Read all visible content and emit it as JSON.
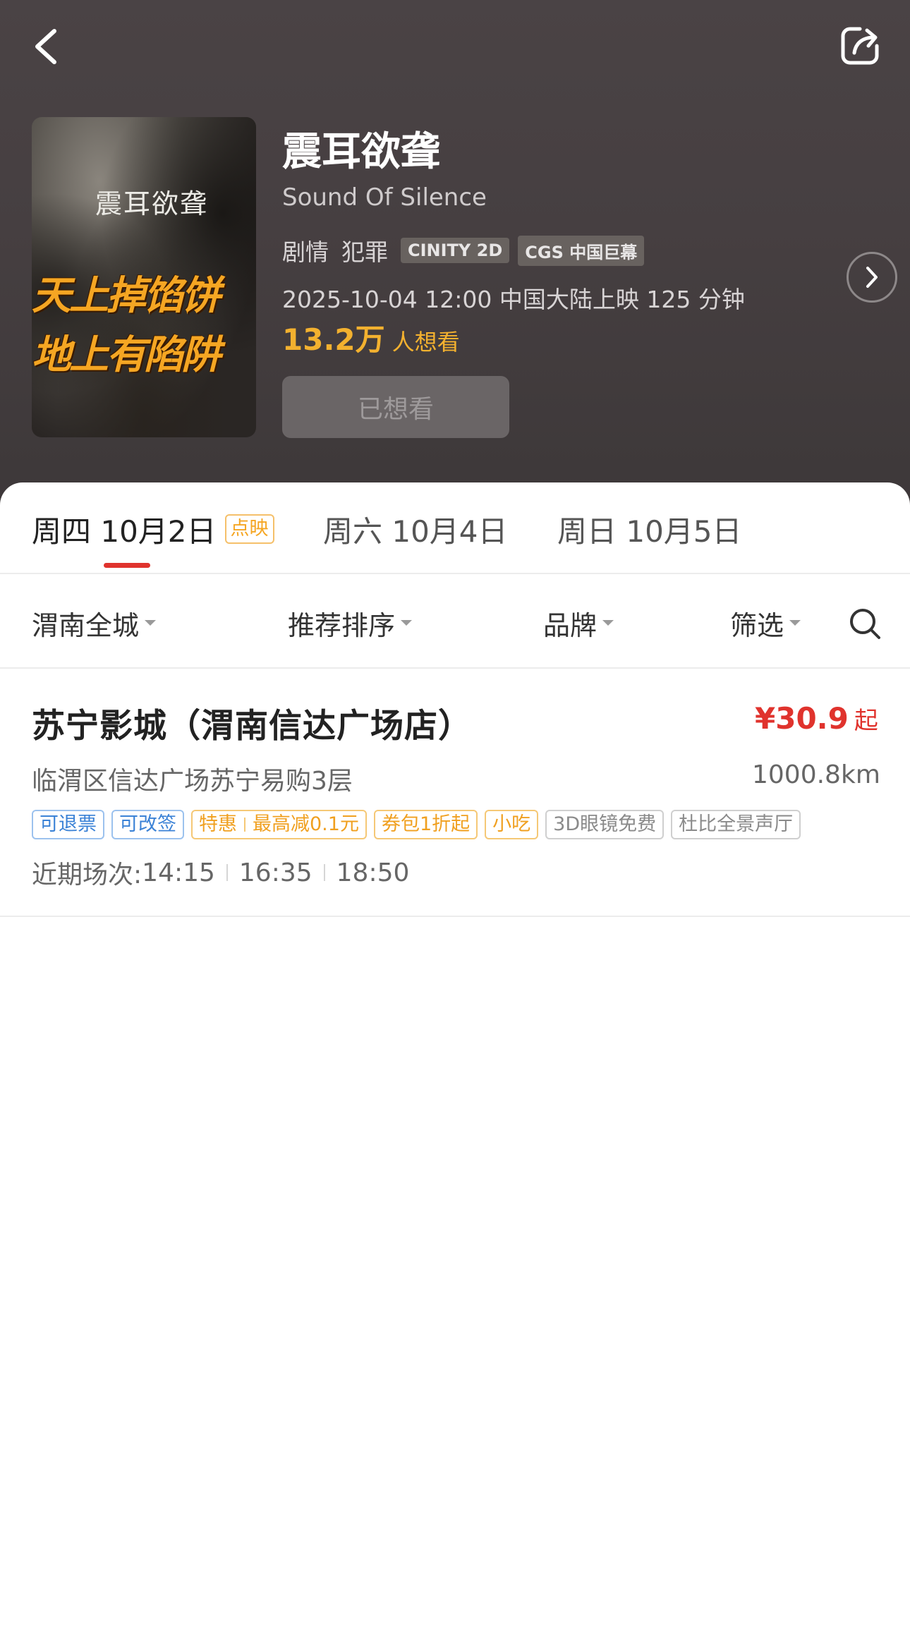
{
  "header": {
    "back_icon": "chevron-left-icon",
    "share_icon": "share-icon"
  },
  "movie": {
    "poster_title": "震耳欲聋",
    "poster_slogan_line1": "天上掉馅饼",
    "poster_slogan_line2": "地上有陷阱",
    "title_cn": "震耳欲聋",
    "title_en": "Sound Of Silence",
    "genres": [
      "剧情",
      "犯罪"
    ],
    "formats": [
      "CINITY 2D",
      "CGS 中国巨幕"
    ],
    "release_info": "2025-10-04 12:00 中国大陆上映 125 分钟",
    "want_count": "13.2万",
    "want_label": "人想看",
    "wanted_button": "已想看"
  },
  "date_tabs": [
    {
      "label": "周四 10月2日",
      "badge": "点映",
      "active": true
    },
    {
      "label": "周六 10月4日",
      "badge": "",
      "active": false
    },
    {
      "label": "周日 10月5日",
      "badge": "",
      "active": false
    }
  ],
  "filters": {
    "city": "渭南全城",
    "sort": "推荐排序",
    "brand": "品牌",
    "screen": "筛选",
    "search_icon": "search-icon"
  },
  "cinemas": [
    {
      "name": "苏宁影城（渭南信达广场店）",
      "price": "¥30.9",
      "price_suffix": "起",
      "address": "临渭区信达广场苏宁易购3层",
      "distance": "1000.8km",
      "tags": {
        "refund": "可退票",
        "change": "可改签",
        "deal": "特惠",
        "deal_detail": "最高减0.1元",
        "voucher": "券包1折起",
        "snack": "小吃",
        "glasses": "3D眼镜免费",
        "dolby": "杜比全景声厅"
      },
      "showtimes_label": "近期场次: ",
      "showtimes": [
        "14:15",
        "16:35",
        "18:50"
      ]
    }
  ],
  "colors": {
    "accent_red": "#e0332d",
    "want_orange": "#f3b12f",
    "tag_blue": "#3b82d6",
    "tag_orange": "#f0a020",
    "header_bg": "#463f41"
  }
}
